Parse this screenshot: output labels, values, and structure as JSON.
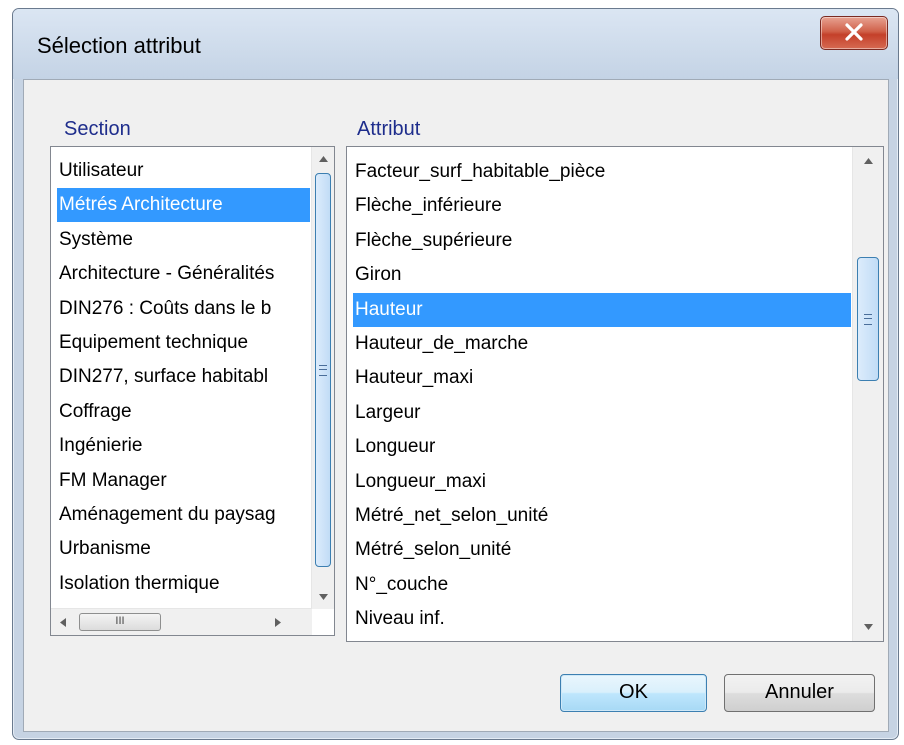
{
  "window": {
    "title": "Sélection attribut"
  },
  "section": {
    "label": "Section",
    "items": [
      "Utilisateur",
      "Métrés Architecture",
      "Système",
      "Architecture - Généralités",
      "DIN276 : Coûts dans le b",
      "Equipement technique",
      "DIN277, surface habitabl",
      "Coffrage",
      "Ingénierie",
      "FM Manager",
      "Aménagement du paysag",
      "Urbanisme",
      "Isolation thermique"
    ],
    "selected": "Métrés Architecture",
    "hscroll_thumb_text": "III"
  },
  "attribut": {
    "label": "Attribut",
    "items": [
      "Facteur_surf_habitable_pièce",
      "Flèche_inférieure",
      "Flèche_supérieure",
      "Giron",
      "Hauteur",
      "Hauteur_de_marche",
      "Hauteur_maxi",
      "Largeur",
      "Longueur",
      "Longueur_maxi",
      "Métré_net_selon_unité",
      "Métré_selon_unité",
      "N°_couche",
      "Niveau inf."
    ],
    "selected": "Hauteur"
  },
  "buttons": {
    "ok": "OK",
    "cancel": "Annuler"
  },
  "colors": {
    "selection": "#3399ff",
    "label_text": "#1e2d8c",
    "close_red": "#c4402a"
  },
  "icons": {
    "close": "close-icon",
    "scroll_up": "arrow-up-icon",
    "scroll_down": "arrow-down-icon",
    "scroll_left": "arrow-left-icon",
    "scroll_right": "arrow-right-icon",
    "grip": "grip-icon"
  }
}
